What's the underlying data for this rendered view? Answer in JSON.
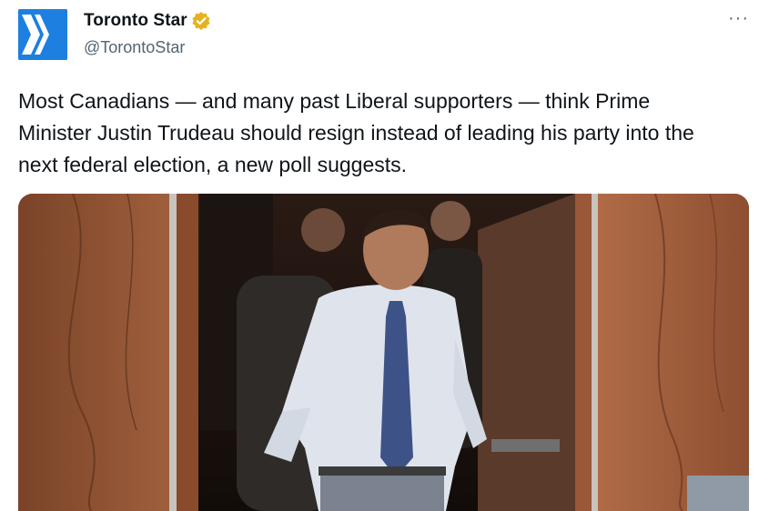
{
  "tweet": {
    "display_name": "Toronto Star",
    "handle": "@TorontoStar",
    "more_menu": "···",
    "text": "Most Canadians — and many past Liberal supporters — think Prime\nMinister Justin Trudeau should resign instead of leading his party into the\nnext federal election, a new poll suggests."
  },
  "icons": {
    "avatar": "toronto-star-logo-icon",
    "verified": "verified-badge-icon",
    "more": "more-options-icon"
  },
  "colors": {
    "avatar_bg": "#1d7fe0",
    "verified_badge": "#e6b11f",
    "handle_text": "#536471"
  }
}
